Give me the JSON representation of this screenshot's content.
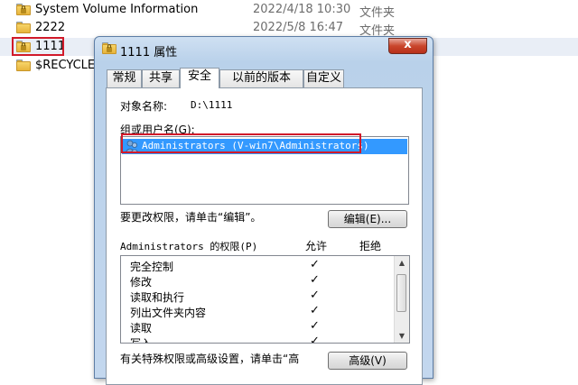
{
  "explorer": {
    "rows": [
      {
        "name": "System Volume Information",
        "date": "2022/4/18 10:30",
        "type": "文件夹"
      },
      {
        "name": "2222",
        "date": "2022/5/8 16:47",
        "type": "文件夹"
      },
      {
        "name": "1111",
        "date": "",
        "type": ""
      },
      {
        "name": "$RECYCLE.BIN",
        "date": "",
        "type": ""
      }
    ]
  },
  "dialog": {
    "title": "1111 属性",
    "close_glyph": "x",
    "tabs": [
      "常规",
      "共享",
      "安全",
      "以前的版本",
      "自定义"
    ],
    "active_tab": "安全",
    "object_name_label": "对象名称:",
    "object_name_value": "D:\\1111",
    "group_label": "组或用户名(G):",
    "selected_user": "Administrators (V-win7\\Administrators)",
    "change_perm_text": "要更改权限，请单击“编辑”。",
    "edit_button": "编辑(E)...",
    "perm_header": "Administrators 的权限(P)",
    "allow_header": "允许",
    "deny_header": "拒绝",
    "permissions": [
      {
        "name": "完全控制",
        "allow": "✓"
      },
      {
        "name": "修改",
        "allow": "✓"
      },
      {
        "name": "读取和执行",
        "allow": "✓"
      },
      {
        "name": "列出文件夹内容",
        "allow": "✓"
      },
      {
        "name": "读取",
        "allow": "✓"
      },
      {
        "name": "写入",
        "allow": "✓"
      }
    ],
    "special_text": "有关特殊权限或高级设置，请单击“高",
    "advanced_button": "高级(V)"
  },
  "colors": {
    "highlight": "#d11a2a",
    "selection": "#3399ff"
  }
}
